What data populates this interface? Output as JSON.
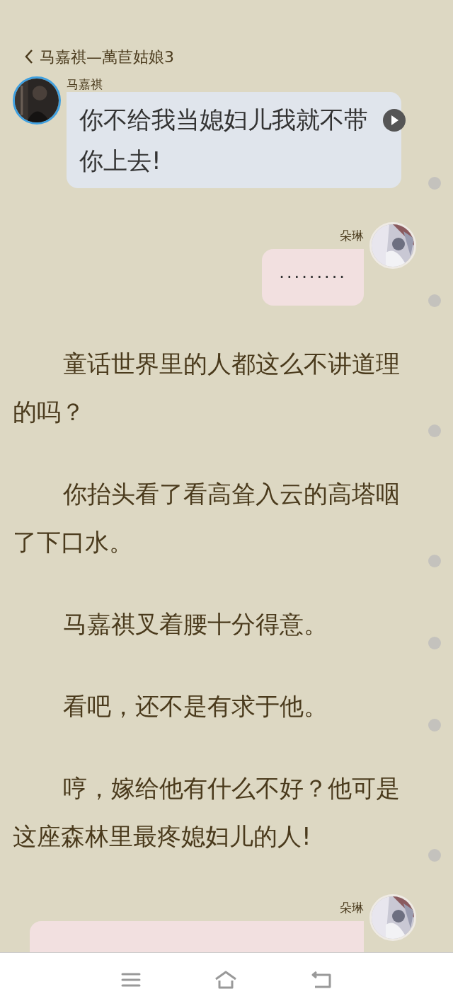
{
  "header": {
    "title": "马嘉祺—萬苣姑娘3"
  },
  "items": [
    {
      "kind": "left_message",
      "name": "马嘉祺",
      "text": "你不给我当媳妇儿我就不带你上去!"
    },
    {
      "kind": "right_message",
      "name": "朵琳",
      "text": "·········"
    },
    {
      "kind": "paragraph",
      "text": "童话世界里的人都这么不讲道理的吗？"
    },
    {
      "kind": "paragraph",
      "text": "你抬头看了看高耸入云的高塔咽了下口水。"
    },
    {
      "kind": "paragraph",
      "text": "马嘉祺叉着腰十分得意。"
    },
    {
      "kind": "paragraph",
      "text": "看吧，还不是有求于他。"
    },
    {
      "kind": "paragraph",
      "text": "哼，嫁给他有什么不好？他可是这座森林里最疼媳妇儿的人!"
    },
    {
      "kind": "right_message",
      "name": "朵琳"
    }
  ]
}
